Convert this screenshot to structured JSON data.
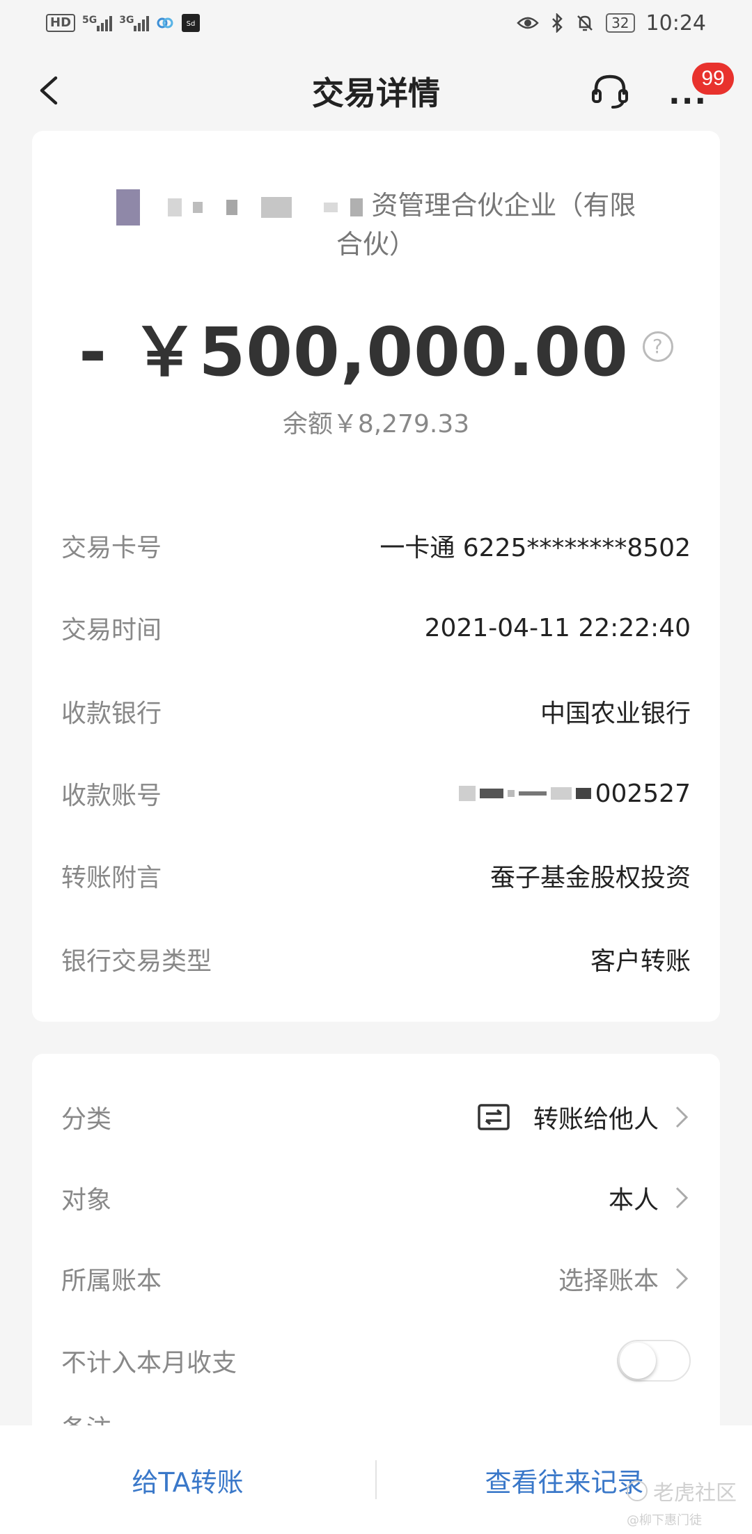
{
  "status_bar": {
    "left_icons": [
      "hd-icon",
      "5g-signal-icon",
      "3g-signal-icon",
      "app-icon-1",
      "app-icon-2"
    ],
    "hd_label": "HD",
    "net1": "5G",
    "net2": "3G",
    "battery": "32",
    "time": "10:24"
  },
  "header": {
    "title": "交易详情",
    "badge": "99"
  },
  "transaction": {
    "payee_visible": "资管理合伙企业（有限",
    "payee_line2": "合伙）",
    "amount": "- ￥500,000.00",
    "balance": "余额￥8,279.33",
    "details": [
      {
        "label": "交易卡号",
        "value": "一卡通 6225********8502"
      },
      {
        "label": "交易时间",
        "value": "2021-04-11 22:22:40"
      },
      {
        "label": "收款银行",
        "value": "中国农业银行"
      },
      {
        "label": "收款账号",
        "value": "002527"
      },
      {
        "label": "转账附言",
        "value": "蚕子基金股权投资"
      },
      {
        "label": "银行交易类型",
        "value": "客户转账"
      }
    ]
  },
  "settings": {
    "category": {
      "label": "分类",
      "value": "转账给他人"
    },
    "target": {
      "label": "对象",
      "value": "本人"
    },
    "ledger": {
      "label": "所属账本",
      "value": "选择账本"
    },
    "exclude": {
      "label": "不计入本月收支",
      "enabled": false
    },
    "note_label": "备注"
  },
  "bottom": {
    "left_button": "给TA转账",
    "right_button": "查看往来记录"
  },
  "watermark": {
    "title": "老虎社区",
    "subtitle": "@柳下惠门徒"
  },
  "colors": {
    "link_blue": "#3a78c9",
    "badge_red": "#e8322d"
  }
}
